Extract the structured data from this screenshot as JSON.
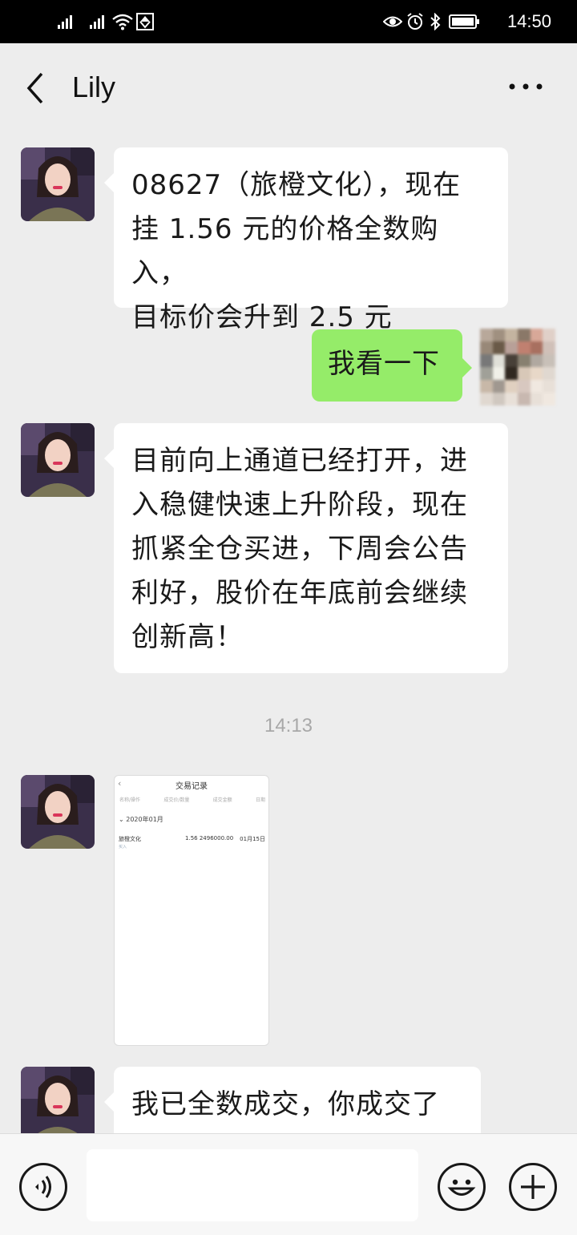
{
  "status_bar": {
    "time": "14:50",
    "icons": [
      "signal-icon",
      "signal-icon",
      "wifi-icon",
      "data-icon",
      "eye-icon",
      "alarm-icon",
      "bluetooth-icon",
      "battery-icon"
    ]
  },
  "header": {
    "title": "Lily",
    "back_icon": "chevron-left-icon",
    "more_icon": "more-icon"
  },
  "messages": [
    {
      "sender": "Lily",
      "side": "left",
      "type": "text",
      "lines": [
        "08627（旅橙文化），现在",
        "挂 1.56 元的价格全数购入，",
        "目标价会升到 2.5 元"
      ]
    },
    {
      "sender": "me",
      "side": "right",
      "type": "text",
      "lines": [
        "我看一下"
      ]
    },
    {
      "sender": "Lily",
      "side": "left",
      "type": "text",
      "lines": [
        "目前向上通道已经打开，进",
        "入稳健快速上升阶段，现在",
        "抓紧全仓买进，下周会公告",
        "利好，股价在年底前会继续",
        "创新高！"
      ]
    },
    {
      "type": "timestamp",
      "text": "14:13"
    },
    {
      "sender": "Lily",
      "side": "left",
      "type": "image",
      "screenshot": {
        "title": "交易记录",
        "columns": [
          "名称/操作",
          "成交价/数量",
          "成交金额",
          "日期"
        ],
        "month": "2020年01月",
        "row": {
          "name": "旅橙文化",
          "price_qty": "1.56 2496000.00",
          "date": "01月15日",
          "sub": "买入"
        }
      }
    },
    {
      "sender": "Lily",
      "side": "left",
      "type": "text",
      "lines": [
        "我已全数成交，你成交了"
      ]
    }
  ],
  "input_bar": {
    "placeholder": "",
    "voice_icon": "voice-icon",
    "emoji_icon": "emoji-icon",
    "plus_icon": "plus-icon"
  },
  "colors": {
    "background": "#ededed",
    "bubble_self": "#95ec69",
    "bubble_other": "#ffffff",
    "status_bar": "#000000"
  }
}
